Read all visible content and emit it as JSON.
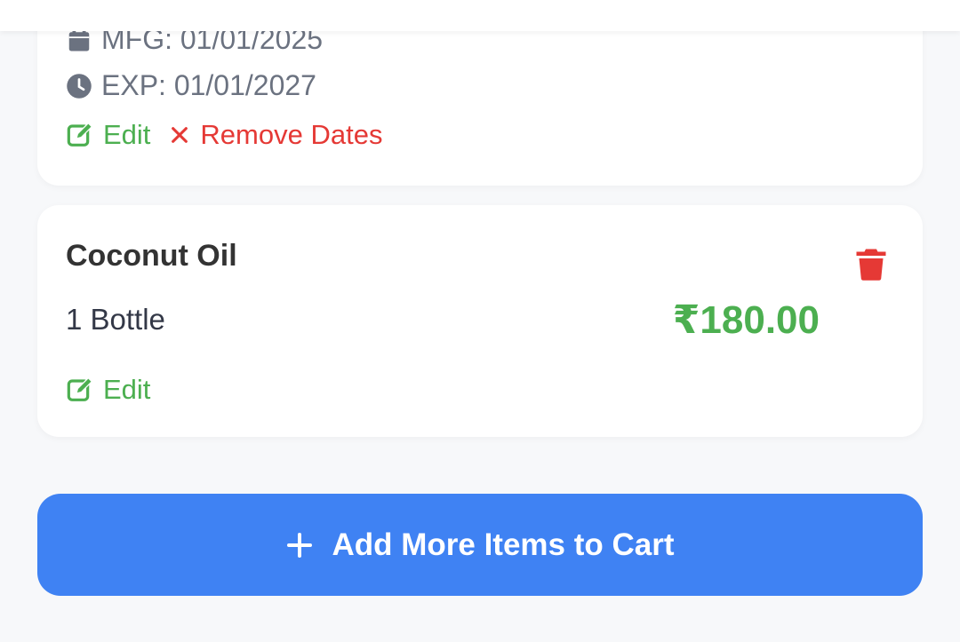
{
  "previous_item": {
    "mfg_label": "MFG: 01/01/2025",
    "exp_label": "EXP: 01/01/2027",
    "edit_label": "Edit",
    "remove_dates_label": "Remove Dates"
  },
  "cart_item": {
    "name": "Coconut Oil",
    "quantity": "1 Bottle",
    "price": "₹180.00",
    "edit_label": "Edit"
  },
  "add_more_button": {
    "label": "Add More Items to Cart",
    "icon": "plus-icon"
  },
  "colors": {
    "primary": "#3f82f3",
    "success": "#4caf50",
    "danger": "#e53935",
    "muted_text": "#6b7280"
  }
}
